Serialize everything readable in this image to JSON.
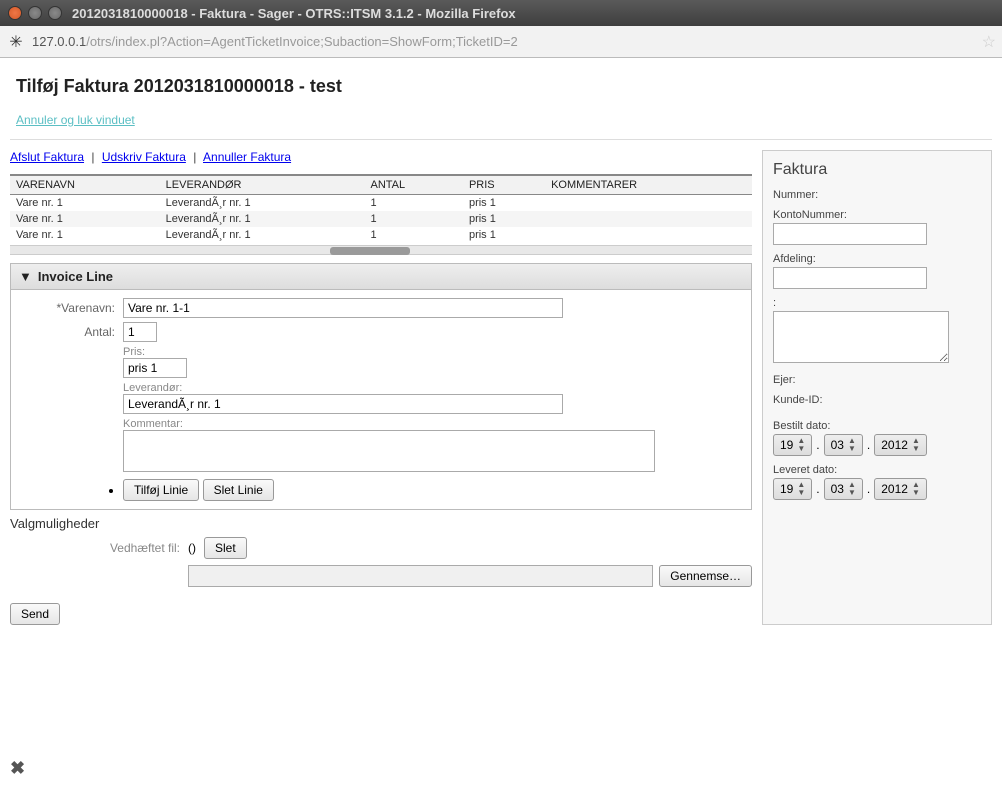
{
  "window": {
    "title": "2012031810000018 - Faktura - Sager - OTRS::ITSM 3.1.2 - Mozilla Firefox"
  },
  "address": {
    "host": "127.0.0.1",
    "path": "/otrs/index.pl?Action=AgentTicketInvoice;Subaction=ShowForm;TicketID=2"
  },
  "header": {
    "title": "Tilføj Faktura    2012031810000018 - test",
    "cancel": "Annuler og luk vinduet"
  },
  "actions": {
    "a": "Afslut Faktura",
    "b": "Udskriv Faktura",
    "c": "Annuller Faktura"
  },
  "table": {
    "cols": {
      "c1": "VARENAVN",
      "c2": "LEVERANDØR",
      "c3": "ANTAL",
      "c4": "PRIS",
      "c5": "KOMMENTARER"
    },
    "rows": [
      {
        "c1": "Vare nr. 1",
        "c2": "LeverandÃ¸r nr. 1",
        "c3": "1",
        "c4": "pris 1",
        "c5": ""
      },
      {
        "c1": "Vare nr. 1",
        "c2": "LeverandÃ¸r nr. 1",
        "c3": "1",
        "c4": "pris 1",
        "c5": ""
      },
      {
        "c1": "Vare nr. 1",
        "c2": "LeverandÃ¸r nr. 1",
        "c3": "1",
        "c4": "pris 1",
        "c5": ""
      }
    ]
  },
  "invoiceLine": {
    "title": "Invoice Line",
    "label_varenavn": "*Varenavn:",
    "varenavn": "Vare nr. 1-1",
    "label_antal": "Antal:",
    "antal": "1",
    "label_pris": "Pris:",
    "pris": "pris 1",
    "label_leverandor": "Leverandør:",
    "leverandor": "LeverandÃ¸r nr. 1",
    "label_kommentar": "Kommentar:",
    "kommentar": "",
    "btn_add": "Tilføj Linie",
    "btn_del": "Slet Linie"
  },
  "options": {
    "title": "Valgmuligheder",
    "attach_label": "Vedhæftet fil:",
    "paren": "()",
    "btn_slet": "Slet",
    "btn_browse": "Gennemse…"
  },
  "submit": {
    "label": "Send"
  },
  "side": {
    "title": "Faktura",
    "nummer": "Nummer:",
    "konto": "KontoNummer:",
    "afdeling": "Afdeling:",
    "colon": ":",
    "ejer": "Ejer:",
    "kunde": "Kunde-ID:",
    "bestilt": "Bestilt dato:",
    "leveret": "Leveret dato:",
    "d": "19",
    "m": "03",
    "y": "2012",
    "d2": "19",
    "m2": "03",
    "y2": "2012",
    "dot": "."
  }
}
